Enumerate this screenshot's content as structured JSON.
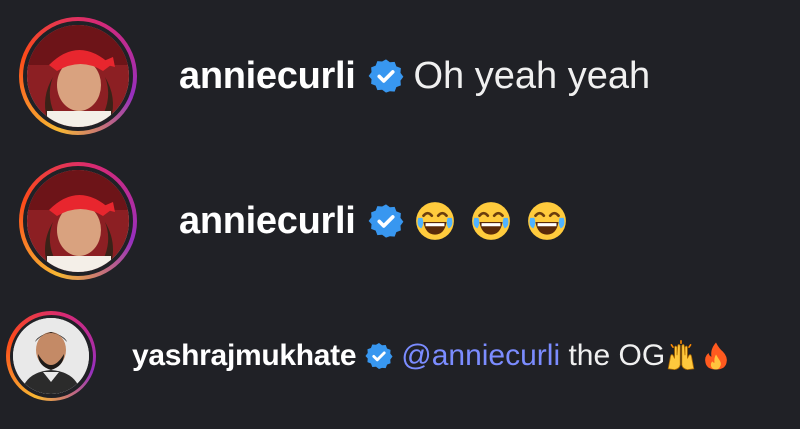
{
  "comments": [
    {
      "username": "anniecurli",
      "text": "Oh yeah yeah",
      "verified": true,
      "emojis": []
    },
    {
      "username": "anniecurli",
      "text": "",
      "verified": true,
      "emojis": [
        "face-with-tears-of-joy",
        "face-with-tears-of-joy",
        "face-with-tears-of-joy"
      ]
    },
    {
      "username": "yashrajmukhate",
      "mention": "@anniecurli",
      "text": " the OG",
      "verified": true,
      "emojis": [
        "raising-hands",
        "fire"
      ]
    }
  ],
  "colors": {
    "background": "#202126",
    "verified_badge": "#3897f0",
    "mention": "#7b8cff",
    "story_ring": [
      "#f7b733",
      "#fc4a1a",
      "#d62976",
      "#962fbf"
    ]
  }
}
